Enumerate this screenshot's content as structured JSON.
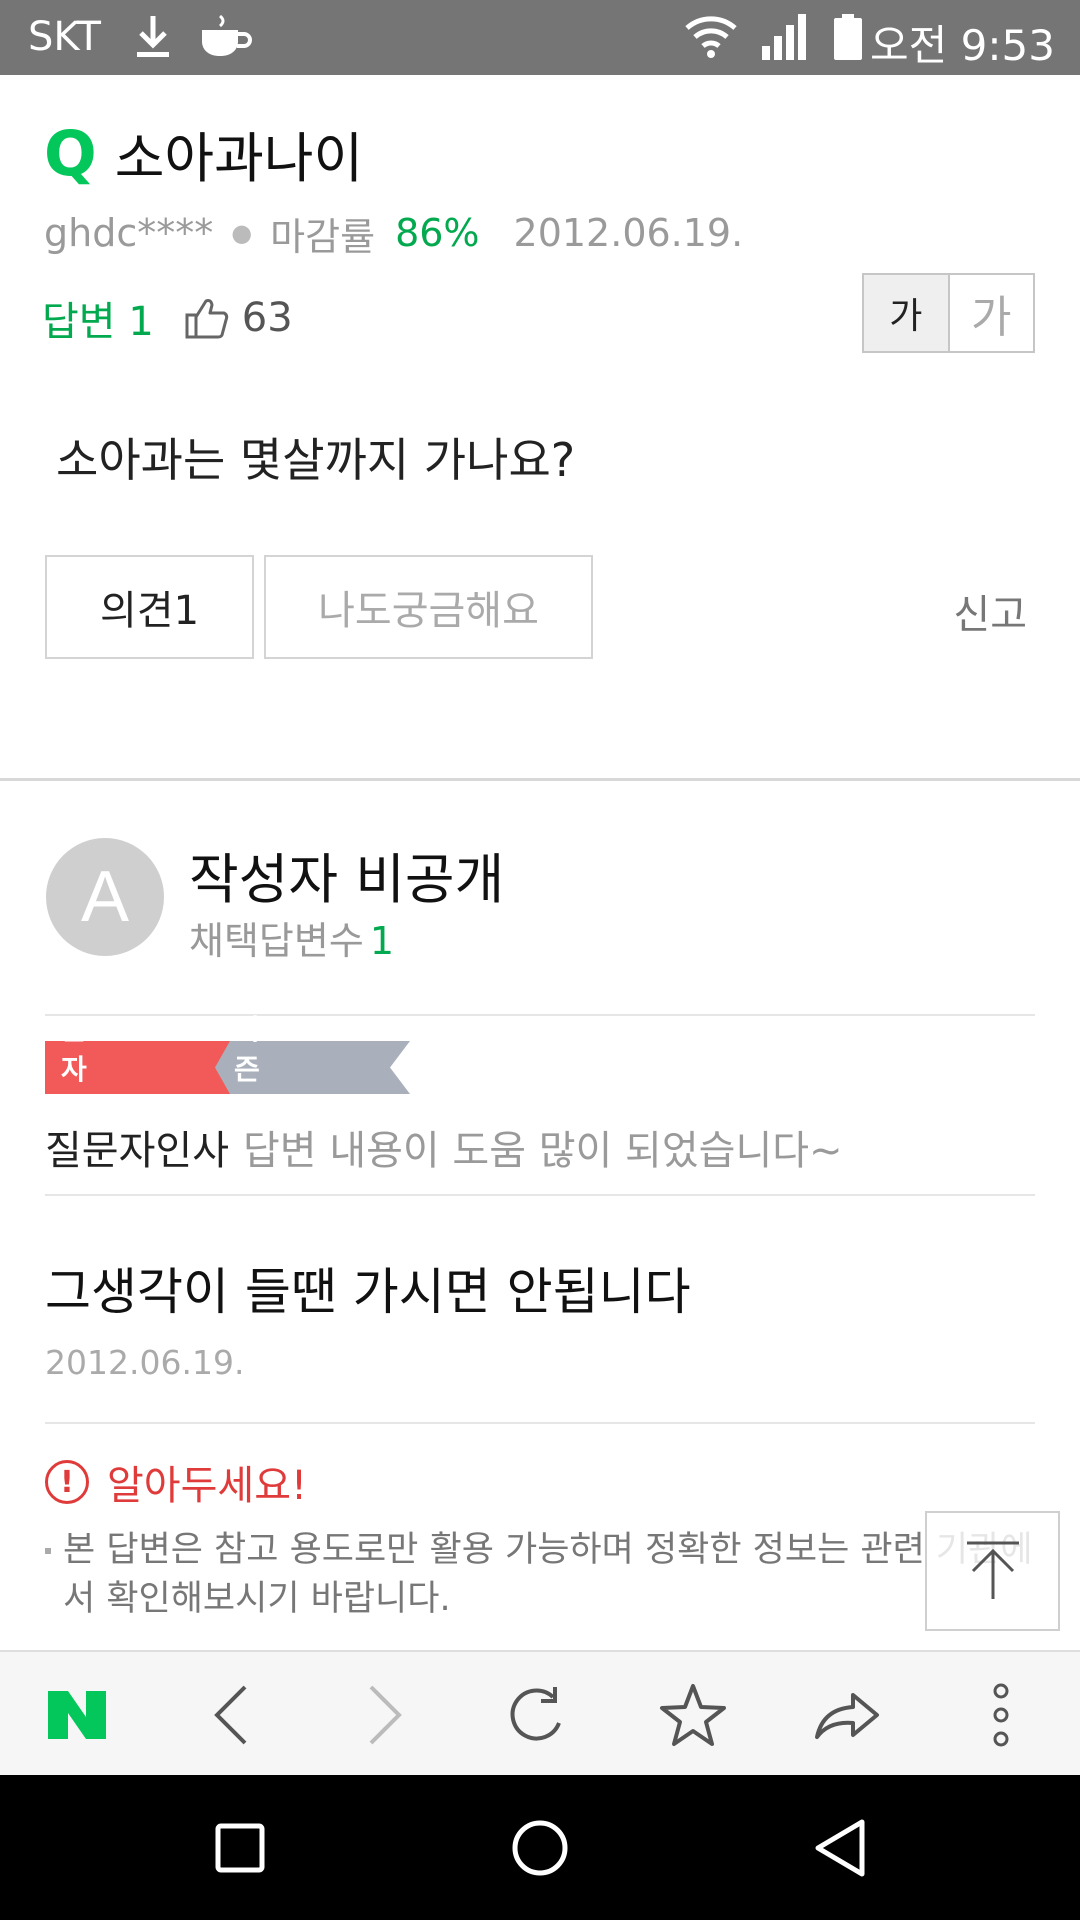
{
  "status_bar": {
    "carrier": "SKT",
    "time": "오전 9:53",
    "icons": [
      "download-icon",
      "coffee-icon",
      "wifi-icon",
      "signal-icon",
      "battery-icon"
    ]
  },
  "question": {
    "q_mark": "Q",
    "title": "소아과나이",
    "author": "ghdc****",
    "close_rate_label": "마감률",
    "close_rate": "86%",
    "date": "2012.06.19.",
    "answers_label": "답변 1",
    "likes": "63",
    "font_small": "가",
    "font_large": "가",
    "body": "소아과는 몇살까지 가나요?",
    "opinion_button": "의견1",
    "curious_button": "나도궁금해요",
    "report": "신고"
  },
  "answer": {
    "avatar_letter": "A",
    "author_name": "작성자 비공개",
    "adopted_label": "채택답변수",
    "adopted_count": "1",
    "badge_asker": "질문자 채택",
    "badge_netizen": "네티즌 채택",
    "thanks_label": "질문자인사",
    "thanks_text": "답변 내용이 도움 많이 되었습니다~",
    "text": "그생각이 들땐 가시면 안됩니다",
    "date": "2012.06.19."
  },
  "notice": {
    "title": "알아두세요!",
    "line1": "본 답변은 참고 용도로만 활용 가능하며 정확한 정보는 관련 기관에",
    "line2": "서 확인해보시기 바랍니다."
  },
  "colors": {
    "accent_green": "#03c75a",
    "badge_red": "#f25a5a",
    "badge_gray": "#a9b0bb",
    "notice_red": "#e03b3b",
    "status_bar": "#757575"
  }
}
